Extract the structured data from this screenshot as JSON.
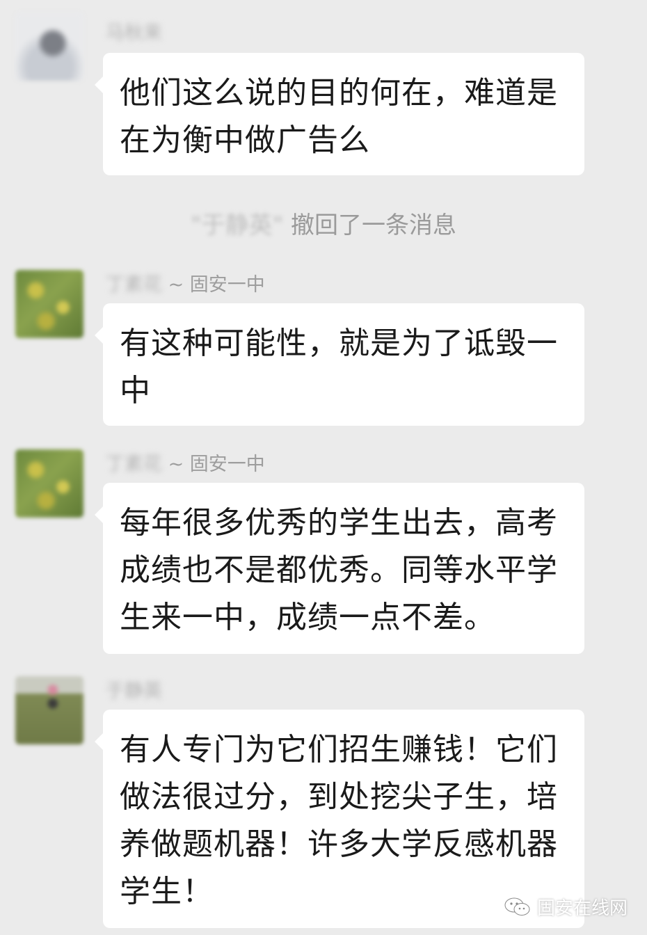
{
  "messages": [
    {
      "sender_name": "马秋来",
      "sender_group": "",
      "text": "他们这么说的目的何在，难道是在为衡中做广告么"
    },
    {
      "sender_name": "丁素花",
      "sender_group": " ~ 固安一中",
      "text": "有这种可能性，就是为了诋毁一中"
    },
    {
      "sender_name": "丁素花",
      "sender_group": " ~ 固安一中",
      "text": "每年很多优秀的学生出去，高考成绩也不是都优秀。同等水平学生来一中，成绩一点不差。"
    },
    {
      "sender_name": "于静英",
      "sender_group": "",
      "text": "有人专门为它们招生赚钱！它们做法很过分，到处挖尖子生，培养做题机器！许多大学反感机器学生！"
    }
  ],
  "system_notice": {
    "quoted_name": "\"于静英\"",
    "text": " 撤回了一条消息"
  },
  "watermark": {
    "text": "固安在线网",
    "icon": "wechat-icon"
  },
  "colors": {
    "background": "#ebebeb",
    "bubble": "#ffffff",
    "text": "#1a1a1a",
    "meta": "#9a9a9a"
  }
}
